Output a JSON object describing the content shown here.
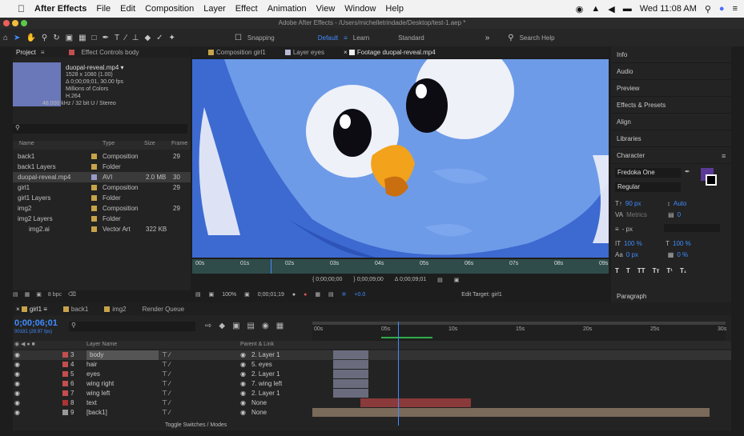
{
  "menubar": {
    "app_name": "After Effects",
    "items": [
      "File",
      "Edit",
      "Composition",
      "Layer",
      "Effect",
      "Animation",
      "View",
      "Window",
      "Help"
    ],
    "clock": "Wed 11:08 AM"
  },
  "window": {
    "title": "Adobe After Effects - /Users/michelletrindade/Desktop/test-1.aep *"
  },
  "toolbar": {
    "snapping_label": "Snapping",
    "workspaces": [
      "Default",
      "Learn",
      "Standard"
    ],
    "active_workspace": "Default",
    "search_placeholder": "Search Help"
  },
  "project_panel": {
    "tab_label": "Project",
    "effect_controls_label": "Effect Controls body",
    "preview": {
      "name": "duopal-reveal.mp4 ▾",
      "line1": "1528 x 1080 (1.00)",
      "line2": "Δ 0;00;09;01, 30.00 fps",
      "line3": "Millions of Colors",
      "line4": "H.264",
      "line5": "48.000 kHz / 32 bit U / Stereo"
    },
    "columns": {
      "name": "Name",
      "type": "Type",
      "size": "Size",
      "frame": "Frame"
    },
    "items": [
      {
        "name": "back1",
        "type": "Composition",
        "size": "",
        "frame": "29",
        "color": "#c7a34a",
        "depth": 0
      },
      {
        "name": "back1 Layers",
        "type": "Folder",
        "size": "",
        "frame": "",
        "color": "#c7a34a",
        "depth": 0
      },
      {
        "name": "duopal-reveal.mp4",
        "type": "AVI",
        "size": "2.0 MB",
        "frame": "30",
        "color": "#9a9ac8",
        "depth": 0
      },
      {
        "name": "girl1",
        "type": "Composition",
        "size": "",
        "frame": "29",
        "color": "#c7a34a",
        "depth": 0
      },
      {
        "name": "girl1 Layers",
        "type": "Folder",
        "size": "",
        "frame": "",
        "color": "#c7a34a",
        "depth": 0
      },
      {
        "name": "img2",
        "type": "Composition",
        "size": "",
        "frame": "29",
        "color": "#c7a34a",
        "depth": 0
      },
      {
        "name": "img2 Layers",
        "type": "Folder",
        "size": "",
        "frame": "",
        "color": "#c7a34a",
        "depth": 0
      },
      {
        "name": "img2.ai",
        "type": "Vector Art",
        "size": "322 KB",
        "frame": "",
        "color": "#c7a34a",
        "depth": 1
      }
    ],
    "bpc_label": "8 bpc"
  },
  "viewer": {
    "tabs": [
      "Composition girl1",
      "Layer eyes",
      "Footage duopal-reveal.mp4"
    ],
    "ruler_labels": [
      "00s",
      "01s",
      "02s",
      "03s",
      "04s",
      "05s",
      "06s",
      "07s",
      "08s",
      "09s"
    ],
    "time_in": "0;00;00;00",
    "time_out": "0;00;09;00",
    "duration": "Δ 0;00;09;01",
    "zoom": "100%",
    "current_time": "0;00;01;19",
    "offset": "+0.0",
    "edit_target": "Edit Target: girl1"
  },
  "right_panel": {
    "items": [
      "Info",
      "Audio",
      "Preview",
      "Effects & Presets",
      "Align",
      "Libraries",
      "Character"
    ],
    "font_name": "Fredoka One",
    "font_style": "Regular",
    "size": "90 px",
    "leading": "Auto",
    "kerning": "Metrics",
    "tracking": "0",
    "stroke": "- px",
    "vscale": "100 %",
    "hscale": "100 %",
    "baseline": "0 px",
    "tsume": "0 %",
    "format_buttons": [
      "T",
      "T",
      "TT",
      "Tт",
      "T¹",
      "T₁"
    ],
    "paragraph_label": "Paragraph",
    "fill_color": "#5a3a96"
  },
  "timeline": {
    "tabs": [
      "girl1",
      "back1",
      "img2",
      "Render Queue"
    ],
    "current_time": "0;00;06;01",
    "fps_label": "00181 (29.97 fps)",
    "columns": {
      "layer_name": "Layer Name",
      "parent": "Parent & Link"
    },
    "ruler": [
      "00s",
      "05s",
      "10s",
      "15s",
      "20s",
      "25s",
      "30s"
    ],
    "layers": [
      {
        "num": "3",
        "name": "body",
        "parent": "2. Layer 1",
        "color": "#c24e4e",
        "bar": "#6b6b7e",
        "sel": true
      },
      {
        "num": "4",
        "name": "hair",
        "parent": "5. eyes",
        "color": "#c24e4e",
        "bar": "#6b6b7e",
        "sel": false
      },
      {
        "num": "5",
        "name": "eyes",
        "parent": "2. Layer 1",
        "color": "#c24e4e",
        "bar": "#6b6b7e",
        "sel": false
      },
      {
        "num": "6",
        "name": "wing right",
        "parent": "7. wing left",
        "color": "#c24e4e",
        "bar": "#6b6b7e",
        "sel": false
      },
      {
        "num": "7",
        "name": "wing left",
        "parent": "2. Layer 1",
        "color": "#c24e4e",
        "bar": "#6b6b7e",
        "sel": false
      },
      {
        "num": "8",
        "name": "text",
        "parent": "None",
        "color": "#a33",
        "bar": "#8a3a3a",
        "sel": false
      },
      {
        "num": "9",
        "name": "[back1]",
        "parent": "None",
        "color": "#999",
        "bar": "#7a6a5a",
        "sel": false
      }
    ],
    "toggle_label": "Toggle Switches / Modes"
  }
}
